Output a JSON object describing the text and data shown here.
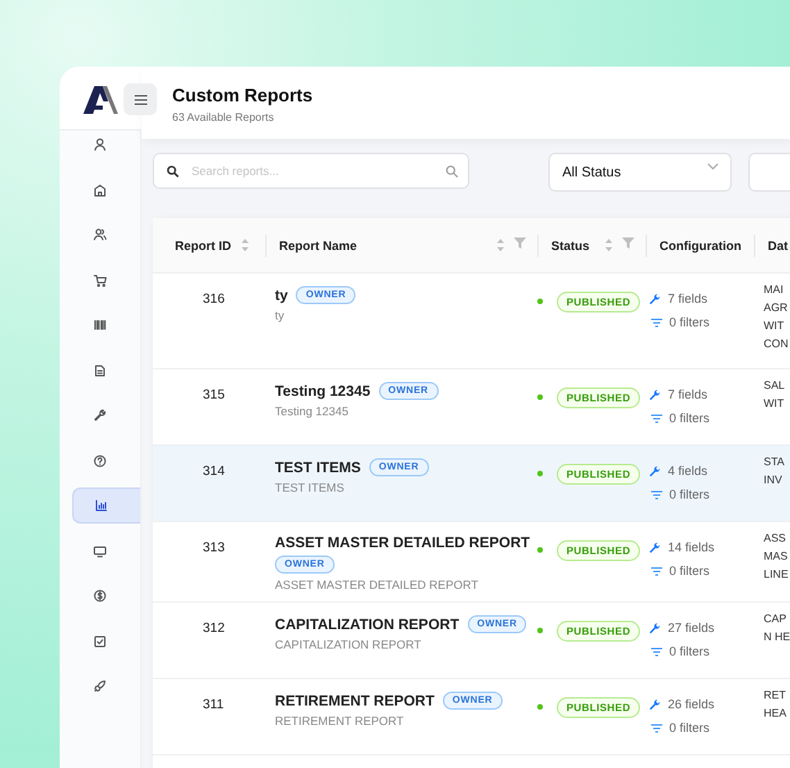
{
  "header": {
    "title": "Custom Reports",
    "subtitle": "63 Available Reports"
  },
  "sidebar": {
    "items": [
      {
        "kind": "user",
        "selected": false
      },
      {
        "kind": "building",
        "selected": false
      },
      {
        "kind": "users",
        "selected": false
      },
      {
        "kind": "cart",
        "selected": false
      },
      {
        "kind": "barcode",
        "selected": false
      },
      {
        "kind": "document",
        "selected": false
      },
      {
        "kind": "wrench",
        "selected": false
      },
      {
        "kind": "help",
        "selected": false
      },
      {
        "kind": "chart",
        "selected": true
      },
      {
        "kind": "monitor",
        "selected": false
      },
      {
        "kind": "dollar",
        "selected": false
      },
      {
        "kind": "check",
        "selected": false
      },
      {
        "kind": "rocket",
        "selected": false
      }
    ]
  },
  "toolbar": {
    "search": {
      "placeholder": "Search reports..."
    },
    "status_filter": {
      "value": "All Status"
    }
  },
  "table": {
    "columns": [
      {
        "label": "Report ID",
        "sortable": true,
        "filterable": false
      },
      {
        "label": "Report Name",
        "sortable": true,
        "filterable": true
      },
      {
        "label": "Status",
        "sortable": true,
        "filterable": true
      },
      {
        "label": "Configuration",
        "sortable": false,
        "filterable": false
      },
      {
        "label": "Dat"
      }
    ],
    "rows": [
      {
        "id": "316",
        "name": "ty",
        "badge": "OWNER",
        "description": "ty",
        "status": "PUBLISHED",
        "fields": "7 fields",
        "filters": "0 filters",
        "data_lines": [
          "MAI",
          "AGR",
          "WIT",
          "CON"
        ],
        "selected": false
      },
      {
        "id": "315",
        "name": "Testing 12345",
        "badge": "OWNER",
        "description": "Testing 12345",
        "status": "PUBLISHED",
        "fields": "7 fields",
        "filters": "0 filters",
        "data_lines": [
          "SAL",
          "WIT"
        ],
        "selected": false
      },
      {
        "id": "314",
        "name": "TEST ITEMS",
        "badge": "OWNER",
        "description": "TEST ITEMS",
        "status": "PUBLISHED",
        "fields": "4 fields",
        "filters": "0 filters",
        "data_lines": [
          "STA",
          "INV"
        ],
        "selected": true
      },
      {
        "id": "313",
        "name": "ASSET MASTER DETAILED REPORT",
        "badge": "OWNER",
        "description": "ASSET MASTER DETAILED REPORT",
        "status": "PUBLISHED",
        "fields": "14 fields",
        "filters": "0 filters",
        "data_lines": [
          "ASS",
          "MAS",
          "LINE"
        ],
        "selected": false
      },
      {
        "id": "312",
        "name": "CAPITALIZATION REPORT",
        "badge": "OWNER",
        "description": "CAPITALIZATION REPORT",
        "status": "PUBLISHED",
        "fields": "27 fields",
        "filters": "0 filters",
        "data_lines": [
          "CAP",
          "N HE"
        ],
        "selected": false
      },
      {
        "id": "311",
        "name": "RETIREMENT REPORT",
        "badge": "OWNER",
        "description": "RETIREMENT REPORT",
        "status": "PUBLISHED",
        "fields": "26 fields",
        "filters": "0 filters",
        "data_lines": [
          "RET",
          "HEA"
        ],
        "selected": false
      }
    ]
  }
}
